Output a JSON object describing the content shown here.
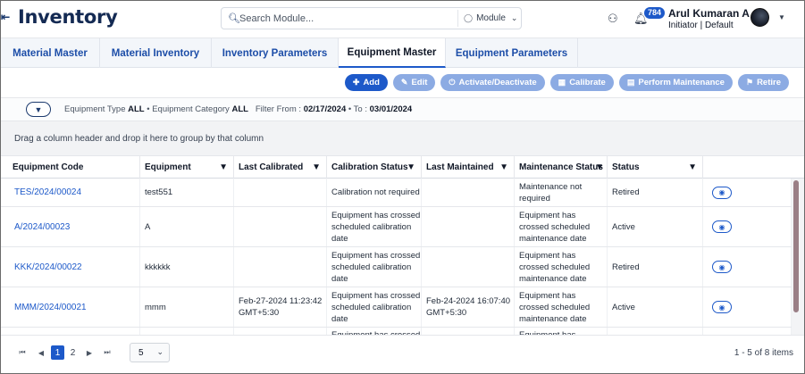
{
  "header": {
    "menu_icon": "menu-icon",
    "title": "Inventory",
    "search": {
      "placeholder": "Search Module...",
      "value": ""
    },
    "module_select": "Module",
    "notifications_count": "784",
    "user": {
      "name": "Arul Kumaran A",
      "role": "Initiator | Default"
    }
  },
  "tabs": [
    {
      "label": "Material Master"
    },
    {
      "label": "Material Inventory"
    },
    {
      "label": "Inventory Parameters"
    },
    {
      "label": "Equipment Master",
      "active": true
    },
    {
      "label": "Equipment Parameters"
    }
  ],
  "actions": {
    "add": "Add",
    "edit": "Edit",
    "activate": "Activate/Deactivate",
    "calibrate": "Calibrate",
    "maintenance": "Perform Maintenance",
    "retire": "Retire"
  },
  "filter": {
    "type_label": "Equipment Type",
    "type_value": "ALL",
    "category_label": "Equipment Category",
    "category_value": "ALL",
    "from_label": "Filter From :",
    "from_value": "02/17/2024",
    "to_label": "To :",
    "to_value": "03/01/2024"
  },
  "group_panel": "Drag a column header and drop it here to group by that column",
  "grid": {
    "columns": [
      "Equipment Code",
      "Equipment",
      "Last Calibrated",
      "Calibration Status",
      "Last Maintained",
      "Maintenance Status",
      "Status"
    ],
    "rows": [
      {
        "code": "TES/2024/00024",
        "equipment": "test551",
        "last_calibrated": "",
        "calibration_status": "Calibration not required",
        "last_maintained": "",
        "maintenance_status": "Maintenance not required",
        "status": "Retired"
      },
      {
        "code": "A/2024/00023",
        "equipment": "A",
        "last_calibrated": "",
        "calibration_status": "Equipment has crossed scheduled calibration date",
        "last_maintained": "",
        "maintenance_status": "Equipment has crossed scheduled maintenance date",
        "status": "Active"
      },
      {
        "code": "KKK/2024/00022",
        "equipment": "kkkkkk",
        "last_calibrated": "",
        "calibration_status": "Equipment has crossed scheduled calibration date",
        "last_maintained": "",
        "maintenance_status": "Equipment has crossed scheduled maintenance date",
        "status": "Retired"
      },
      {
        "code": "MMM/2024/00021",
        "equipment": "mmm",
        "last_calibrated": "Feb-27-2024 11:23:42 GMT+5:30",
        "calibration_status": "Equipment has crossed scheduled calibration date",
        "last_maintained": "Feb-24-2024 16:07:40 GMT+5:30",
        "maintenance_status": "Equipment has crossed scheduled maintenance date",
        "status": "Active"
      },
      {
        "code": "",
        "equipment": "",
        "last_calibrated": "",
        "calibration_status": "Equipment has crossed",
        "last_maintained": "",
        "maintenance_status": "Equipment has crossed",
        "status": ""
      }
    ]
  },
  "pager": {
    "pages": [
      "1",
      "2"
    ],
    "current_page": "1",
    "page_size": "5",
    "info": "1 - 5 of 8 items"
  },
  "colors": {
    "brand": "#142a53",
    "accent": "#1d59c9",
    "accent_light": "#8cabe3"
  }
}
